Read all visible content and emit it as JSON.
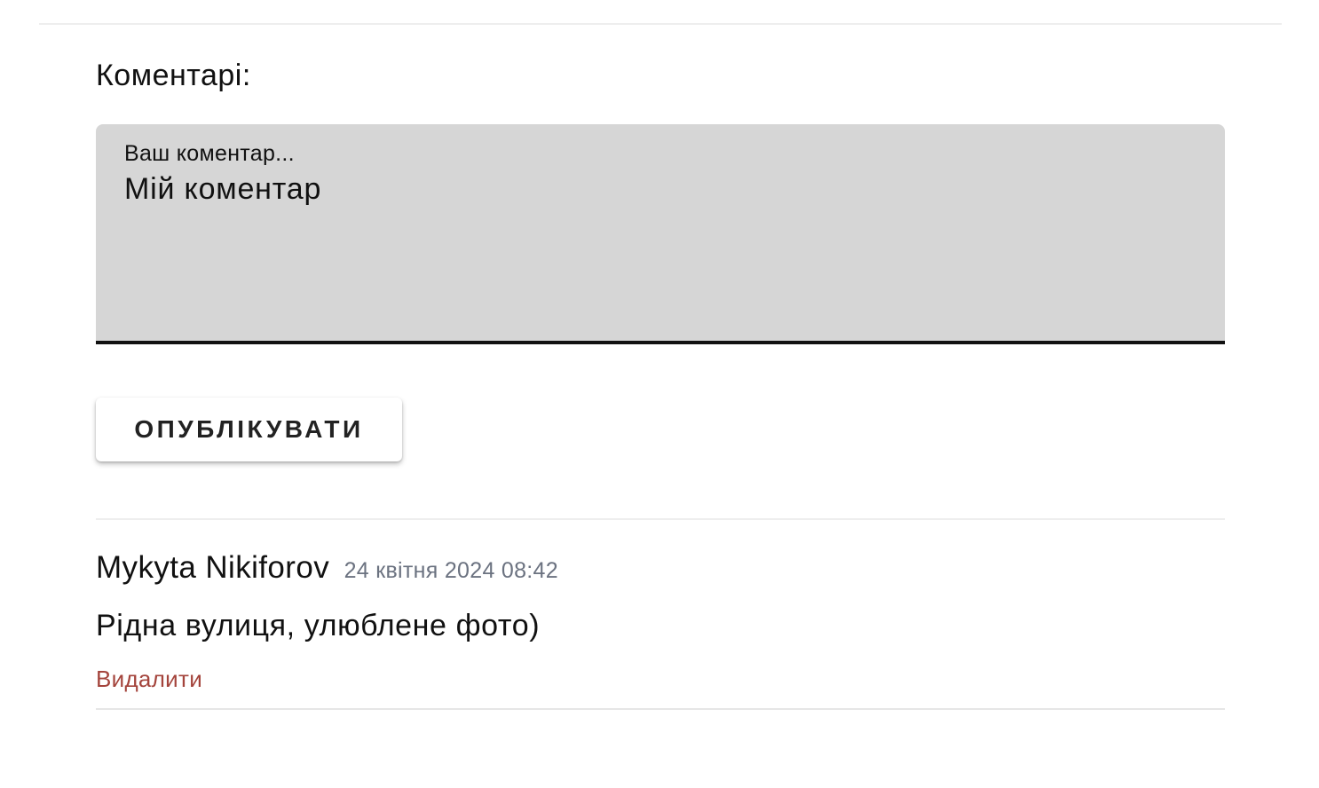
{
  "comments_section": {
    "title": "Коментарі:",
    "form": {
      "field_label": "Ваш коментар...",
      "field_value": "Мій коментар",
      "submit_label": "ОПУБЛІКУВАТИ"
    },
    "comments": [
      {
        "author": "Mykyta Nikiforov",
        "date": "24 квітня 2024 08:42",
        "text": "Рідна вулиця, улюблене фото)",
        "delete_label": "Видалити"
      }
    ]
  },
  "colors": {
    "field_background": "#d6d6d6",
    "delete_link": "#a4443c",
    "date_text": "#6b7280"
  }
}
